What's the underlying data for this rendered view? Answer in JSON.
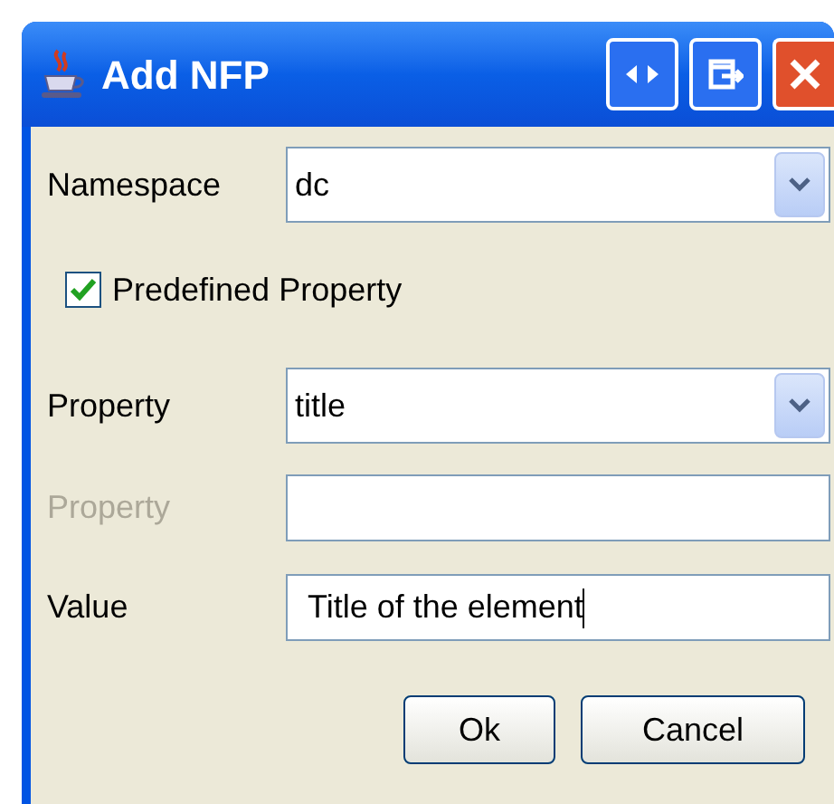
{
  "window": {
    "title": "Add NFP"
  },
  "namespace": {
    "label": "Namespace",
    "value": "dc"
  },
  "predefined": {
    "label": "Predefined Property",
    "checked": true
  },
  "property": {
    "label": "Property",
    "value": "title"
  },
  "custom_property": {
    "label": "Property",
    "disabled": true
  },
  "value_field": {
    "label": "Value",
    "value": "Title of the element"
  },
  "buttons": [
    "Ok",
    "Cancel"
  ]
}
